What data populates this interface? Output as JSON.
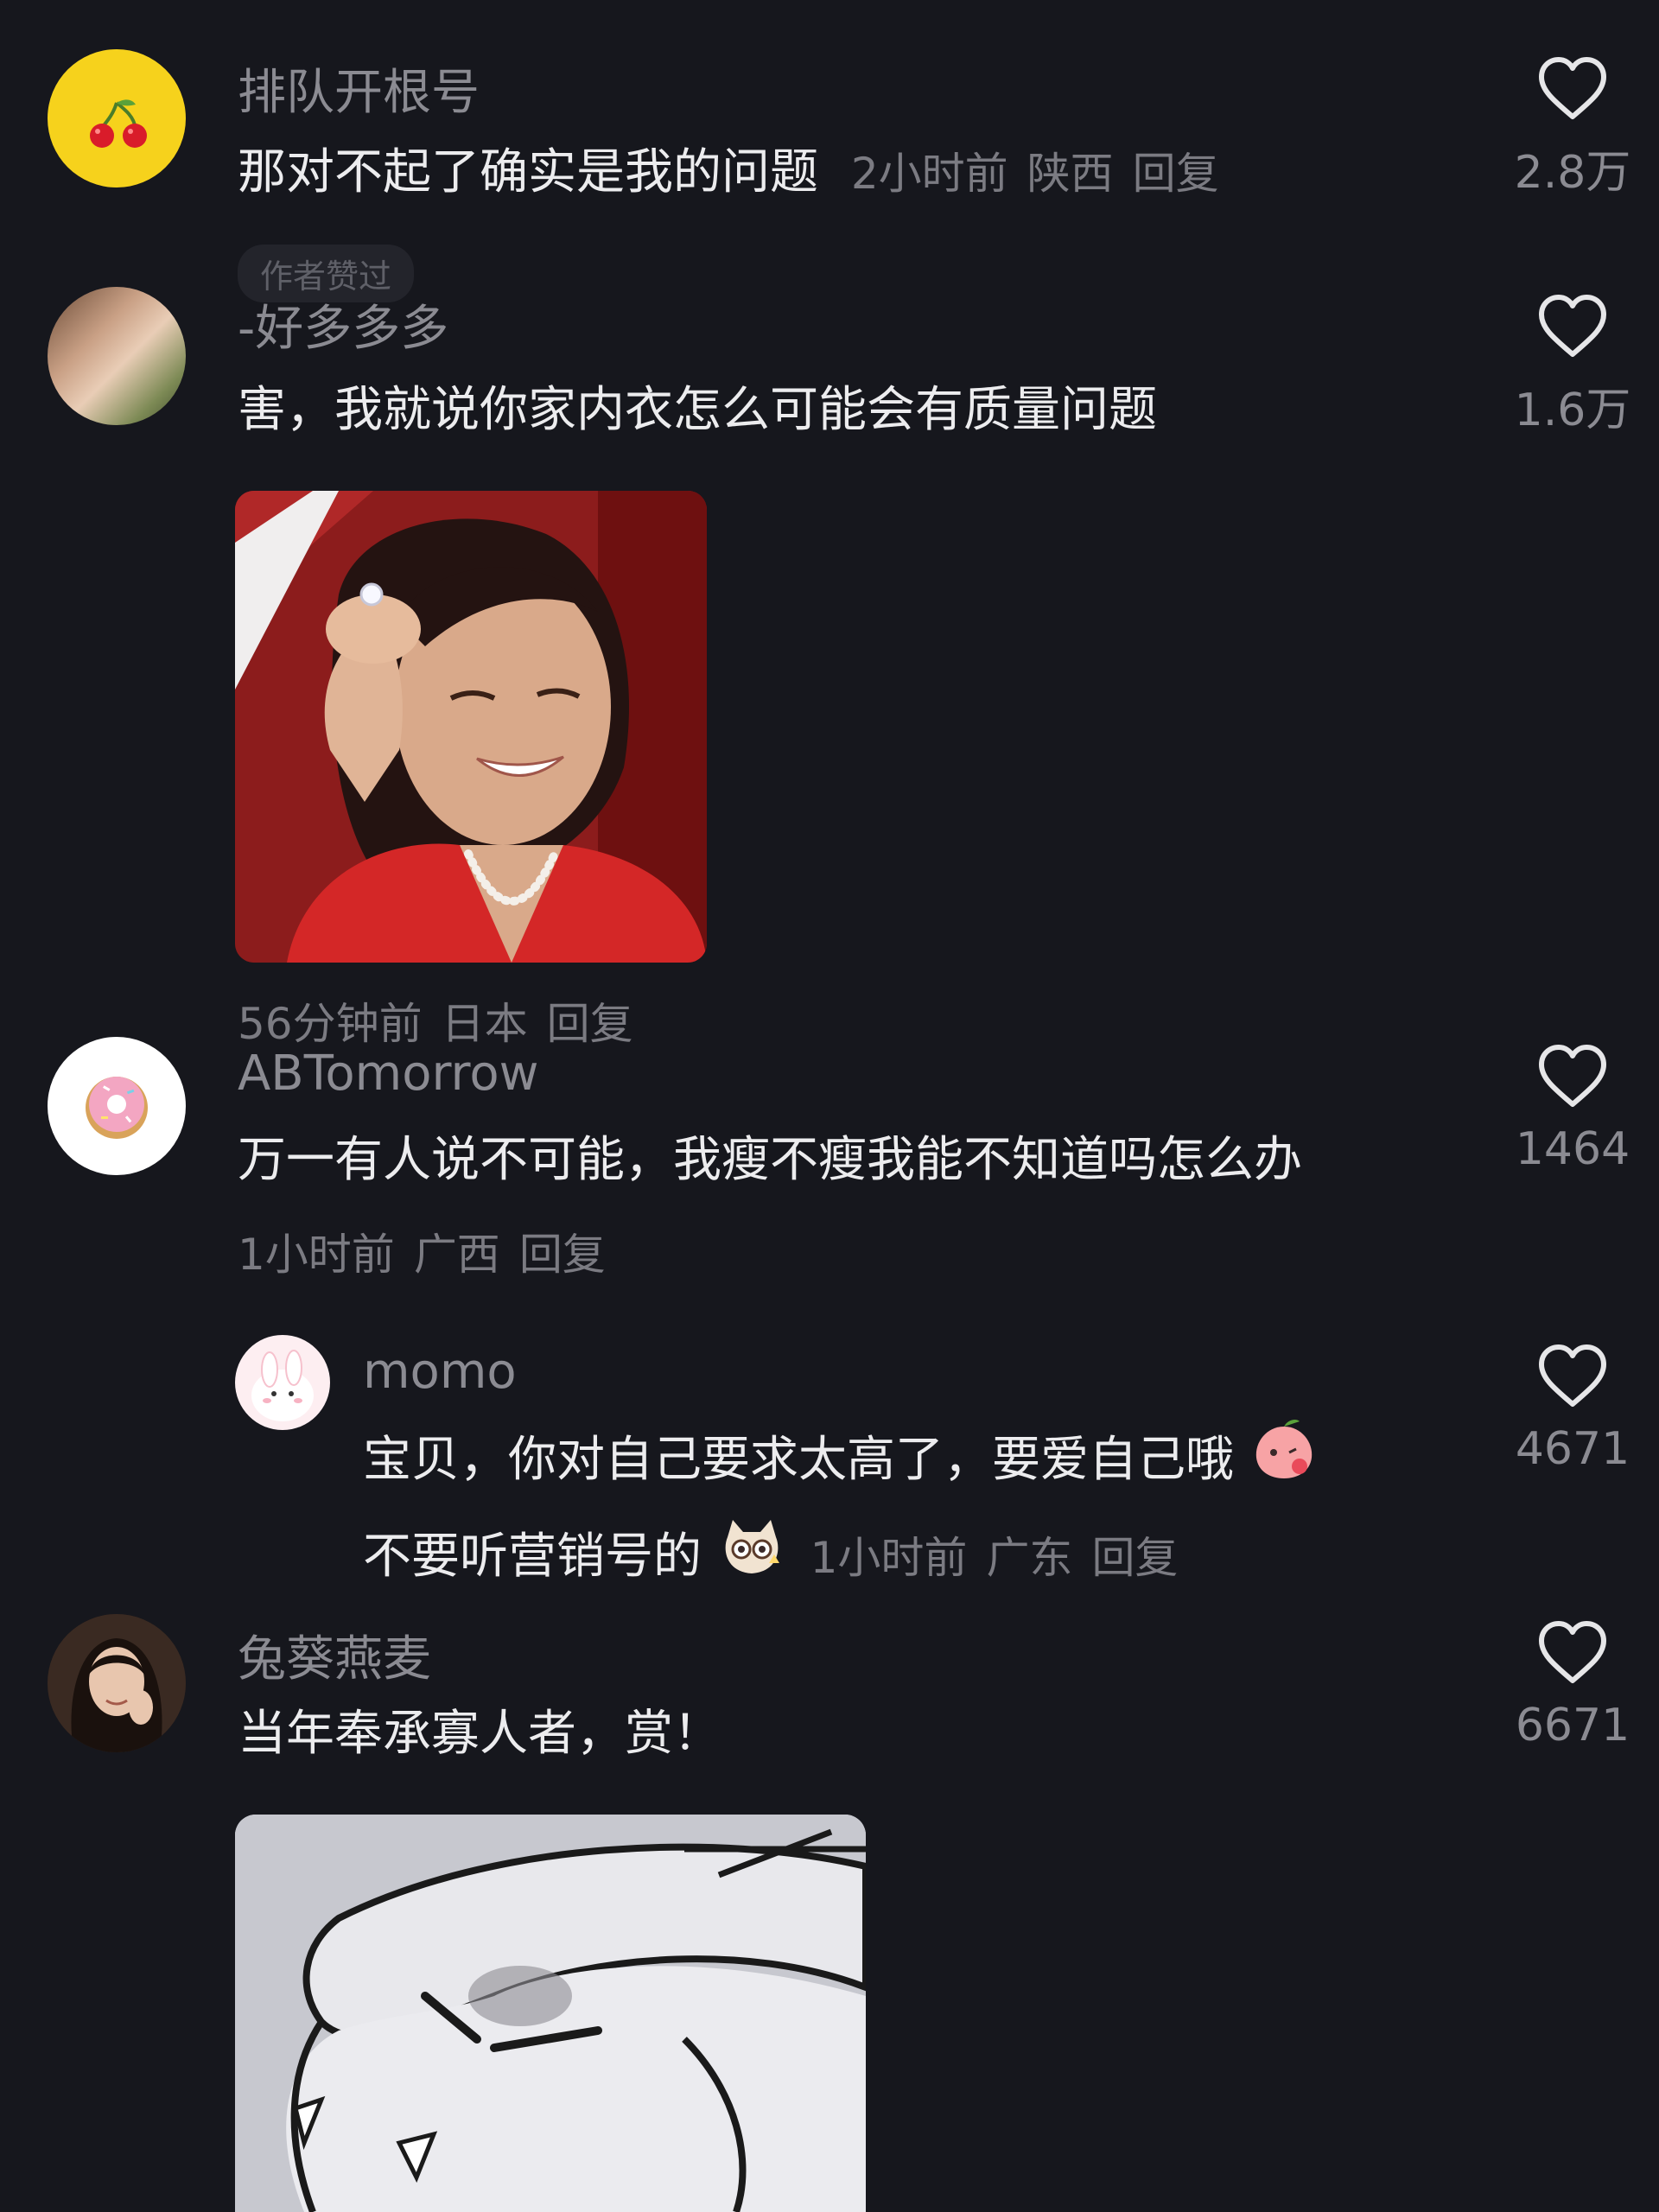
{
  "comments": [
    {
      "username": "排队开根号",
      "text": "那对不起了确实是我的问题",
      "time": "2小时前",
      "location": "陕西",
      "reply": "回复",
      "likes": "2.8万"
    },
    {
      "badge": "作者赞过",
      "username": "-好多多多",
      "text": "害，我就说你家内衣怎么可能会有质量问题",
      "time": "56分钟前",
      "location": "日本",
      "reply": "回复",
      "likes": "1.6万"
    },
    {
      "username": "ABTomorrow",
      "text": "万一有人说不可能，我瘦不瘦我能不知道吗怎么办",
      "time": "1小时前",
      "location": "广西",
      "reply": "回复",
      "likes": "1464"
    },
    {
      "username": "momo",
      "text_line1": "宝贝，你对自己要求太高了，要爱自己哦",
      "text_line2": "不要听营销号的",
      "time": "1小时前",
      "location": "广东",
      "reply": "回复",
      "likes": "4671"
    },
    {
      "username": "兔葵燕麦",
      "text": "当年奉承寡人者，赏！",
      "likes": "6671"
    }
  ],
  "icons": {
    "like": "heart-outline-icon",
    "cherry": "cherry-icon",
    "donut": "donut-icon"
  },
  "colors": {
    "background": "#16171d",
    "cherry_avatar": "#f6d21c"
  }
}
